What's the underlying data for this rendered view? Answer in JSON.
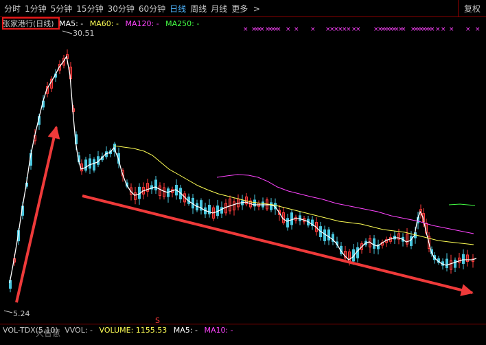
{
  "toolbar": {
    "tabs": [
      "分时",
      "1分钟",
      "5分钟",
      "15分钟",
      "30分钟",
      "60分钟",
      "日线",
      "周线",
      "月线"
    ],
    "active_tab": "日线",
    "more_label": "更多",
    "more_icon": "chevron-right-icon",
    "restore_label": "复权"
  },
  "chart": {
    "stock_title": "张家港行(日线)",
    "ma_legend": [
      {
        "label": "MA5: -",
        "color": "#ffffff"
      },
      {
        "label": "MA60: -",
        "color": "#ffff55"
      },
      {
        "label": "MA120: -",
        "color": "#ff44ff"
      },
      {
        "label": "MA250: -",
        "color": "#44ff44"
      }
    ],
    "high_label": "30.51",
    "low_label": "5.24",
    "s_marker": "S",
    "colors": {
      "up": "#ff3b3b",
      "down": "#4ac8e0",
      "ma5": "#ffffff",
      "ma60": "#ffff55",
      "ma120": "#ff44ff",
      "ma250": "#44ff44",
      "arrow": "#ee3a3a"
    }
  },
  "volume": {
    "legend": [
      {
        "label": "VOL-TDX(5,10)",
        "color": "#c8c8c8"
      },
      {
        "label": "VVOL: -",
        "color": "#c8c8c8"
      },
      {
        "label": "VOLUME: 1155.53",
        "color": "#ffff55"
      },
      {
        "label": "MA5: -",
        "color": "#ffffff"
      },
      {
        "label": "MA10: -",
        "color": "#ff44ff"
      }
    ],
    "watermark": "大智慧"
  }
}
